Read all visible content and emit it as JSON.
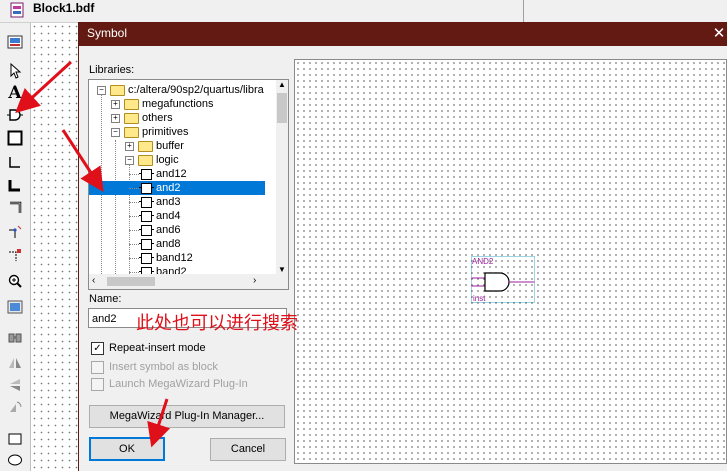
{
  "app": {
    "document_title": "Block1.bdf"
  },
  "dialog": {
    "title": "Symbol",
    "libraries_label": "Libraries:",
    "tree": {
      "items": [
        {
          "label": "c:/altera/90sp2/quartus/libra",
          "type": "folder",
          "expander": "−"
        },
        {
          "label": "megafunctions",
          "type": "folder",
          "expander": "+"
        },
        {
          "label": "others",
          "type": "folder",
          "expander": "+"
        },
        {
          "label": "primitives",
          "type": "folder",
          "expander": "−"
        },
        {
          "label": "buffer",
          "type": "folder",
          "expander": "+"
        },
        {
          "label": "logic",
          "type": "folder",
          "expander": "−"
        },
        {
          "label": "and12",
          "type": "symbol"
        },
        {
          "label": "and2",
          "type": "symbol",
          "selected": true
        },
        {
          "label": "and3",
          "type": "symbol"
        },
        {
          "label": "and4",
          "type": "symbol"
        },
        {
          "label": "and6",
          "type": "symbol"
        },
        {
          "label": "and8",
          "type": "symbol"
        },
        {
          "label": "band12",
          "type": "symbol"
        },
        {
          "label": "band2",
          "type": "symbol"
        }
      ]
    },
    "name_label": "Name:",
    "name_value": "and2",
    "options": {
      "repeat_insert": {
        "label": "Repeat-insert mode",
        "checked": true,
        "enabled": true
      },
      "insert_as_block": {
        "label": "Insert symbol as block",
        "checked": false,
        "enabled": false
      },
      "launch_megawizard": {
        "label": "Launch MegaWizard Plug-In",
        "checked": false,
        "enabled": false
      }
    },
    "buttons": {
      "megawizard": "MegaWizard Plug-In Manager...",
      "ok": "OK",
      "cancel": "Cancel"
    },
    "preview": {
      "symbol_name": "AND2",
      "instance_label": "inst",
      "accent_color": "#9b1f9b"
    },
    "close_glyph": "✕"
  },
  "annotation": {
    "text": "此处也可以进行搜索",
    "color": "#e0101a"
  },
  "toolbar": {
    "icons": [
      "symbol-tool-icon",
      "selection-tool-icon",
      "text-tool-icon",
      "symbol-insert-icon",
      "block-tool-icon",
      "orthogonal-node-icon",
      "orthogonal-bus-icon",
      "orthogonal-conduit-icon",
      "rubberbanding-icon",
      "partial-line-icon",
      "zoom-icon",
      "full-screen-icon",
      "find-icon",
      "flip-horizontal-icon",
      "flip-vertical-icon",
      "rotate-icon",
      "rectangle-icon",
      "ellipse-icon"
    ]
  }
}
